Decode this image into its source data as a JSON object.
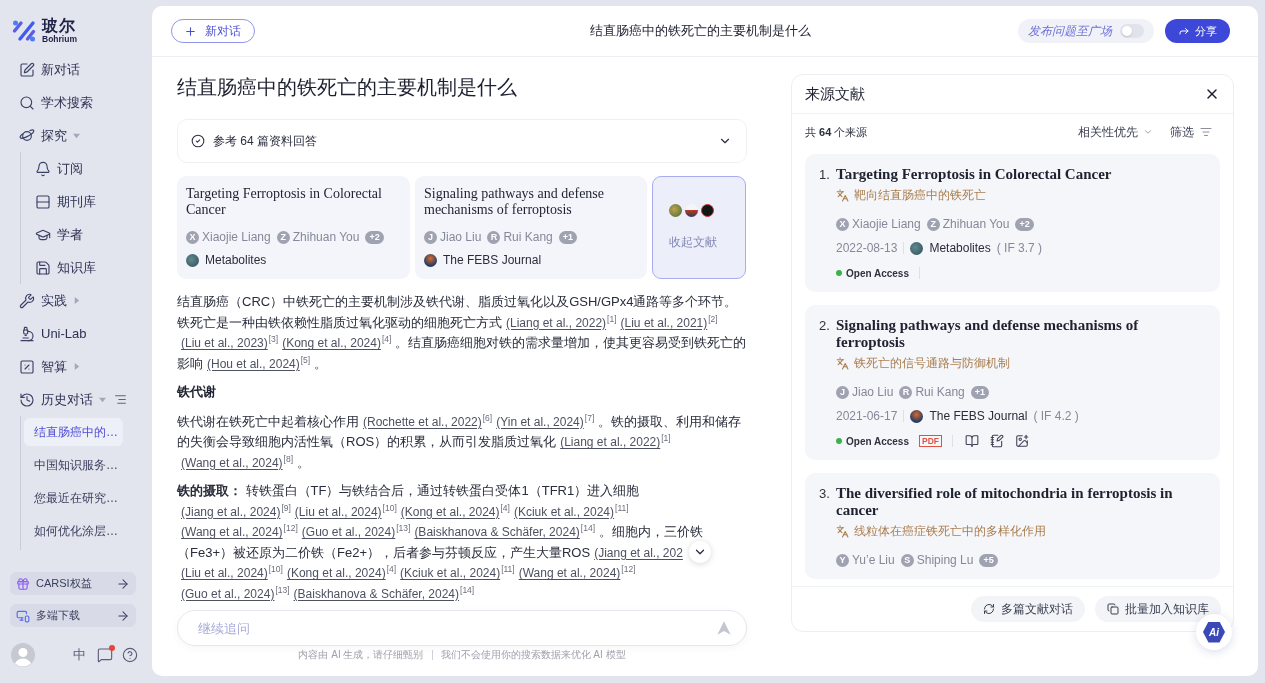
{
  "sidebar": {
    "logo": {
      "name": "玻尔",
      "tagline": "Bohrium"
    },
    "nav": [
      {
        "label": "新对话",
        "kind": "link"
      },
      {
        "label": "学术搜索",
        "kind": "link"
      },
      {
        "label": "探究",
        "kind": "menu",
        "expanded": true,
        "children": [
          {
            "label": "订阅"
          },
          {
            "label": "期刊库"
          },
          {
            "label": "学者"
          },
          {
            "label": "知识库"
          }
        ]
      },
      {
        "label": "实践",
        "kind": "menu",
        "expanded": false
      },
      {
        "label": "Uni-Lab",
        "kind": "link"
      },
      {
        "label": "智算",
        "kind": "menu",
        "expanded": false
      },
      {
        "label": "历史对话",
        "kind": "history",
        "expanded": true,
        "children": [
          {
            "label": "结直肠癌中的…",
            "selected": true
          },
          {
            "label": "中国知识服务…",
            "selected": false
          },
          {
            "label": "您最近在研究…",
            "selected": false
          },
          {
            "label": "如何优化涂层…",
            "selected": false
          }
        ]
      }
    ],
    "promos": [
      {
        "label": "CARSI权益"
      },
      {
        "label": "多端下载"
      }
    ],
    "footer": {
      "language": "中",
      "unread": true
    }
  },
  "topbar": {
    "new_chat": "新对话",
    "title": "结直肠癌中的铁死亡的主要机制是什么",
    "publish": {
      "label": "发布问题至广场",
      "on": false
    },
    "share": "分享"
  },
  "question": "结直肠癌中的铁死亡的主要机制是什么",
  "references": {
    "label": "参考 64 篇资料回答",
    "cards": [
      {
        "title": "Targeting Ferroptosis in Colorectal Cancer",
        "authors": [
          {
            "initial": "X",
            "name": "Xiaojie Liang"
          },
          {
            "initial": "Z",
            "name": "Zhihuan You"
          }
        ],
        "more": "+2",
        "journal": "Metabolites"
      },
      {
        "title": "Signaling pathways and defense mechanisms of ferroptosis",
        "authors": [
          {
            "initial": "J",
            "name": "Jiao Liu"
          },
          {
            "initial": "R",
            "name": "Rui Kang"
          }
        ],
        "more": "+1",
        "journal": "The FEBS Journal"
      }
    ],
    "collapse": "收起文献"
  },
  "answer": [
    {
      "kind": "paragraph",
      "segments": [
        {
          "kind": "text",
          "text": "结直肠癌（CRC）中铁死亡的主要机制涉及铁代谢、脂质过氧化以及GSH/GPx4通路等多个环节。铁死亡是一种由铁依赖性脂质过氧化驱动的细胞死亡方式"
        },
        {
          "kind": "cite",
          "text": "(Liang et al., 2022)",
          "ref": "[1]"
        },
        {
          "kind": "cite",
          "text": "(Liu et al., 2021)",
          "ref": "[2]"
        },
        {
          "kind": "cite",
          "text": "(Liu et al., 2023)",
          "ref": "[3]"
        },
        {
          "kind": "cite",
          "text": "(Kong et al., 2024)",
          "ref": "[4]"
        },
        {
          "kind": "text",
          "text": " 。结直肠癌细胞对铁的需求量增加，使其更容易受到铁死亡的影响"
        },
        {
          "kind": "cite",
          "text": "(Hou et al., 2024)",
          "ref": "[5]"
        },
        {
          "kind": "text",
          "text": " 。"
        }
      ]
    },
    {
      "kind": "heading",
      "text": "铁代谢"
    },
    {
      "kind": "paragraph",
      "segments": [
        {
          "kind": "text",
          "text": "铁代谢在铁死亡中起着核心作用"
        },
        {
          "kind": "cite",
          "text": "(Rochette et al., 2022)",
          "ref": "[6]"
        },
        {
          "kind": "cite",
          "text": "(Yin et al., 2024)",
          "ref": "[7]"
        },
        {
          "kind": "text",
          "text": " 。铁的摄取、利用和储存的失衡会导致细胞内活性氧（ROS）的积累，从而引发脂质过氧化"
        },
        {
          "kind": "cite",
          "text": "(Liang et al., 2022)",
          "ref": "[1]"
        },
        {
          "kind": "cite",
          "text": "(Wang et al., 2024)",
          "ref": "[8]"
        },
        {
          "kind": "text",
          "text": " 。"
        }
      ]
    },
    {
      "kind": "paragraph",
      "segments": [
        {
          "kind": "text",
          "text": "**铁的摄取：** 转铁蛋白（TF）与铁结合后，通过转铁蛋白受体1（TFR1）进入细胞"
        },
        {
          "kind": "cite",
          "text": "(Jiang et al., 2024)",
          "ref": "[9]"
        },
        {
          "kind": "cite",
          "text": "(Liu et al., 2024)",
          "ref": "[10]"
        },
        {
          "kind": "cite",
          "text": "(Kong et al., 2024)",
          "ref": "[4]"
        },
        {
          "kind": "cite",
          "text": "(Kciuk et al., 2024)",
          "ref": "[11]"
        },
        {
          "kind": "cite",
          "text": "(Wang et al., 2024)",
          "ref": "[12]"
        },
        {
          "kind": "cite",
          "text": "(Guo et al., 2024)",
          "ref": "[13]"
        },
        {
          "kind": "cite",
          "text": "(Baiskhanova & Schäfer, 2024)",
          "ref": "[14]"
        },
        {
          "kind": "text",
          "text": " 。细胞内，三价铁（Fe3+）被还原为二价铁（Fe2+），后者参与芬顿反应，产生大量ROS"
        },
        {
          "kind": "cite",
          "text": "(Jiang et al., 202"
        },
        {
          "kind": "scroll"
        },
        {
          "kind": "cite",
          "text": "(Liu et al., 2024)",
          "ref": "[10]"
        },
        {
          "kind": "cite",
          "text": "(Kong et al., 2024)",
          "ref": "[4]"
        },
        {
          "kind": "cite",
          "text": "(Kciuk et al., 2024)",
          "ref": "[11]"
        },
        {
          "kind": "cite",
          "text": "(Wang et al., 2024)",
          "ref": "[12]"
        },
        {
          "kind": "cite",
          "text": "(Guo et al., 2024)",
          "ref": "[13]"
        },
        {
          "kind": "cite",
          "text": "(Baiskhanova & Schäfer, 2024)",
          "ref": "[14]"
        }
      ]
    }
  ],
  "composer": {
    "placeholder": "继续追问",
    "notes": [
      "内容由 AI 生成，请仔细甄别",
      "我们不会使用你的搜索数据来优化 AI 模型"
    ]
  },
  "sources": {
    "title": "来源文献",
    "count": "共 **64** 个来源",
    "sort": "相关性优先",
    "filter": "筛选",
    "items": [
      {
        "number": "1.",
        "title": "Targeting Ferroptosis in Colorectal Cancer",
        "translation": "靶向结直肠癌中的铁死亡",
        "authors": [
          {
            "initial": "X",
            "name": "Xiaojie Liang"
          },
          {
            "initial": "Z",
            "name": "Zhihuan You"
          }
        ],
        "more": "+2",
        "date": "2022-08-13",
        "journal": "Metabolites",
        "impact": "( IF 3.7 )",
        "access": "Open Access",
        "tools": false
      },
      {
        "number": "2.",
        "title": "Signaling pathways and defense mechanisms of ferroptosis",
        "translation": "铁死亡的信号通路与防御机制",
        "authors": [
          {
            "initial": "J",
            "name": "Jiao Liu"
          },
          {
            "initial": "R",
            "name": "Rui Kang"
          }
        ],
        "more": "+1",
        "date": "2021-06-17",
        "journal": "The FEBS Journal",
        "impact": "( IF 4.2 )",
        "access": "Open Access",
        "pdf": "PDF",
        "tools": true
      },
      {
        "number": "3.",
        "title": "The diversified role of mitochondria in ferroptosis in cancer",
        "translation": "线粒体在癌症铁死亡中的多样化作用",
        "authors": [
          {
            "initial": "Y",
            "name": "Yu’e Liu"
          },
          {
            "initial": "S",
            "name": "Shiping Lu"
          }
        ],
        "more": "+5"
      }
    ],
    "actions": [
      "多篇文献对话",
      "批量加入知识库"
    ]
  },
  "ai_button": "Ai"
}
